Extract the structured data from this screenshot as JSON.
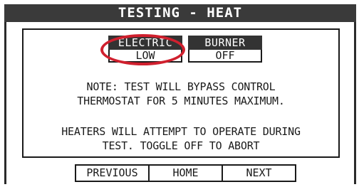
{
  "title": "TESTING - HEAT",
  "modes": {
    "electric": {
      "label": "ELECTRIC",
      "value": "LOW"
    },
    "burner": {
      "label": "BURNER",
      "value": "OFF"
    }
  },
  "notes": [
    "NOTE: TEST WILL BYPASS CONTROL",
    "THERMOSTAT FOR 5 MINUTES MAXIMUM.",
    "HEATERS WILL ATTEMPT TO OPERATE DURING",
    "TEST. TOGGLE OFF TO ABORT"
  ],
  "nav": {
    "previous": "PREVIOUS",
    "home": "HOME",
    "next": "NEXT"
  },
  "colors": {
    "title_bar": "#3a3a3a",
    "highlight": "#d0202e"
  }
}
